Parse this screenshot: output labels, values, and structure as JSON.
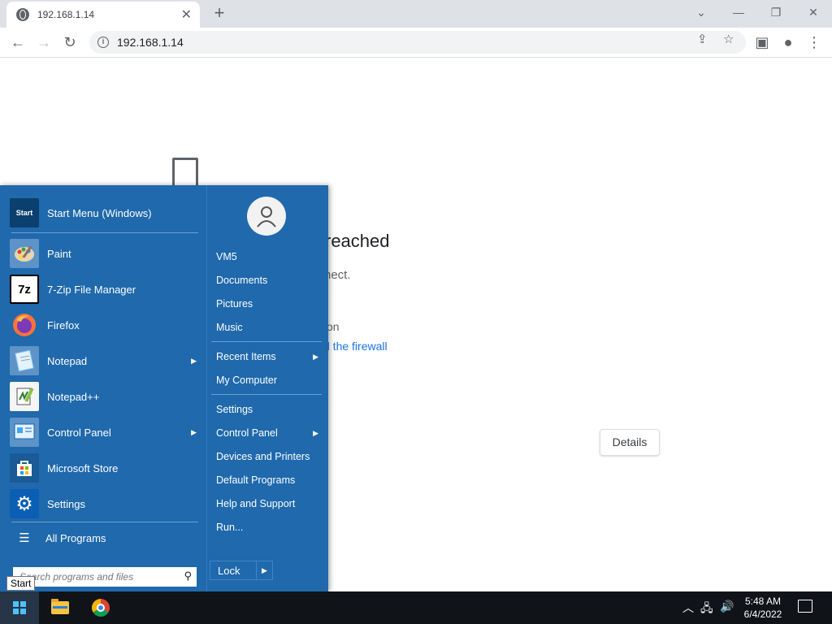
{
  "browser": {
    "tab_title": "192.168.1.14",
    "new_tab_symbol": "+",
    "url": "192.168.1.14",
    "icons": [
      "globe-icon",
      "close-icon",
      "back-icon",
      "forward-icon",
      "reload-icon",
      "info-icon",
      "share-icon",
      "star-icon",
      "sidepanel-icon",
      "profile-icon",
      "menu-icon",
      "minimize-icon",
      "maximize-icon",
      "tab-search-icon"
    ]
  },
  "error_page": {
    "heading": "reached",
    "subtext": "nect.",
    "try_text": "on",
    "link_text": "d the firewall",
    "details_label": "Details"
  },
  "start_menu": {
    "pinned": [
      {
        "label": "Start Menu (Windows)",
        "icon": "start-menu-icon",
        "icon_text": "Start"
      },
      {
        "label": "Paint",
        "icon": "paint-icon"
      },
      {
        "label": "7-Zip File Manager",
        "icon": "7zip-icon",
        "icon_text": "7z"
      },
      {
        "label": "Firefox",
        "icon": "firefox-icon"
      },
      {
        "label": "Notepad",
        "icon": "notepad-icon",
        "has_submenu": true
      },
      {
        "label": "Notepad++",
        "icon": "notepadpp-icon"
      },
      {
        "label": "Control Panel",
        "icon": "control-panel-icon",
        "has_submenu": true
      },
      {
        "label": "Microsoft Store",
        "icon": "store-icon"
      },
      {
        "label": "Settings",
        "icon": "settings-icon"
      }
    ],
    "all_programs": "All Programs",
    "search_placeholder": "Search programs and files",
    "right": {
      "user": "VM5",
      "items_group1": [
        "Documents",
        "Pictures",
        "Music"
      ],
      "items_group2": [
        {
          "label": "Recent Items",
          "has_submenu": true
        },
        {
          "label": "My Computer"
        }
      ],
      "items_group3": [
        {
          "label": "Settings"
        },
        {
          "label": "Control Panel",
          "has_submenu": true
        },
        {
          "label": "Devices and Printers"
        },
        {
          "label": "Default Programs"
        },
        {
          "label": "Help and Support"
        },
        {
          "label": "Run..."
        }
      ],
      "lock_label": "Lock"
    },
    "tooltip": "Start"
  },
  "taskbar": {
    "time": "5:48 AM",
    "date": "6/4/2022",
    "apps": [
      "file-explorer-icon",
      "chrome-icon"
    ]
  },
  "colors": {
    "start_menu_bg": "#1f69ac",
    "taskbar_bg": "#101318",
    "link": "#1a73e8"
  }
}
